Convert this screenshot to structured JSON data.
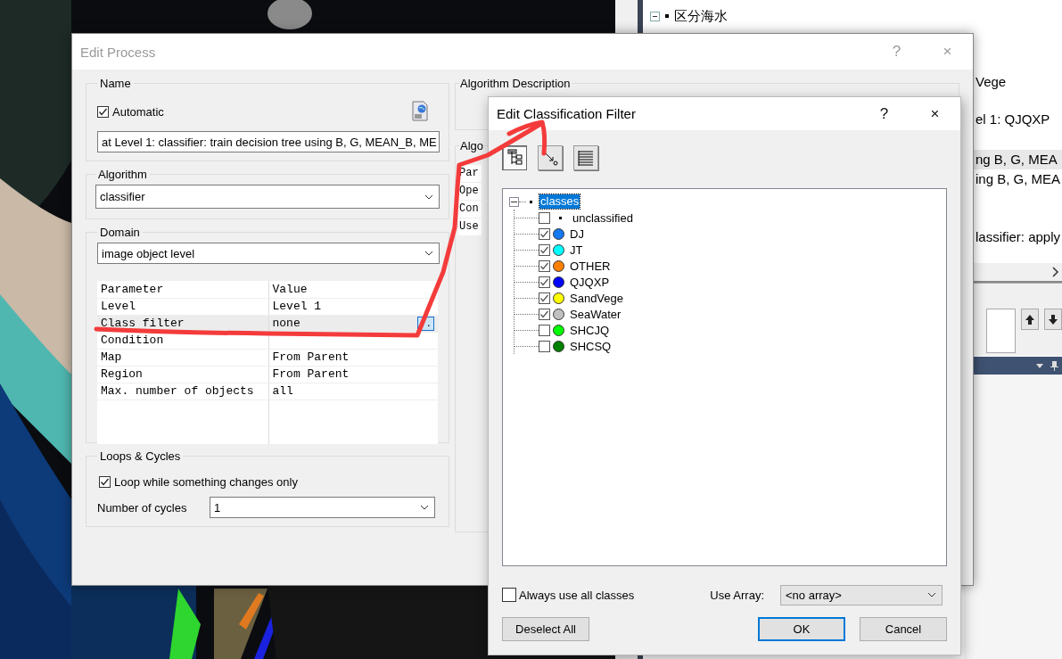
{
  "background_window": {
    "tree_item": {
      "label": "区分海水",
      "expanded": true
    },
    "lines": [
      {
        "text": "Vege",
        "selected": false
      },
      {
        "text": "el 1: QJQXP",
        "selected": false
      },
      {
        "text": "ng B, G, MEA",
        "selected": true
      },
      {
        "text": "ing B, G, MEA",
        "selected": false
      },
      {
        "text": "lassifier: apply",
        "selected": false
      }
    ]
  },
  "edit_process": {
    "title": "Edit Process",
    "controls": [
      "?",
      "×"
    ],
    "name": {
      "label": "Name",
      "automatic": {
        "label": "Automatic",
        "checked": true
      },
      "value": "at  Level 1: classifier: train decision tree using B, G, MEAN_B, ME"
    },
    "algorithm": {
      "label": "Algorithm",
      "value": "classifier"
    },
    "domain": {
      "label": "Domain",
      "value": "image object level",
      "columns": [
        "Parameter",
        "Value"
      ],
      "rows": [
        {
          "parameter": "Level",
          "value": "Level 1",
          "selected": false
        },
        {
          "parameter": "Class filter",
          "value": "none",
          "button": "..",
          "selected": true
        },
        {
          "parameter": "Condition",
          "selected": false
        },
        {
          "parameter": "Map",
          "value": "From Parent",
          "selected": false
        },
        {
          "parameter": "Region",
          "value": "From Parent",
          "selected": false
        },
        {
          "parameter": "Max. number of objects",
          "value": "all",
          "selected": false
        }
      ]
    },
    "loops": {
      "label": "Loops & Cycles",
      "loop": {
        "label": "Loop while something changes only",
        "checked": true
      },
      "cycles_label": "Number of cycles",
      "cycles_value": "1"
    },
    "description": {
      "label": "Algorithm Description"
    },
    "parameters": {
      "label": "Algo",
      "rows": [
        "Par",
        "Ope",
        "Con",
        "Use"
      ]
    }
  },
  "filter_dialog": {
    "title": "Edit Classification Filter",
    "controls": [
      "?",
      "×"
    ],
    "toolbar": [
      {
        "kind": "tree",
        "pressed": true
      },
      {
        "kind": "arrow",
        "pressed": false
      },
      {
        "kind": "list",
        "pressed": false
      }
    ],
    "tree": {
      "label": "classes",
      "expanded": true,
      "selected": true,
      "children": [
        {
          "label": "unclassified",
          "checked": false,
          "kind": "plain"
        },
        {
          "label": "DJ",
          "checked": true,
          "kind": "class",
          "color": "#1478f0"
        },
        {
          "label": "JT",
          "checked": true,
          "kind": "class",
          "color": "#00ffff"
        },
        {
          "label": "OTHER",
          "checked": true,
          "kind": "class",
          "color": "#ff8000"
        },
        {
          "label": "QJQXP",
          "checked": true,
          "kind": "class",
          "color": "#0000ff"
        },
        {
          "label": "SandVege",
          "checked": true,
          "kind": "class",
          "color": "#ffff00"
        },
        {
          "label": "SeaWater",
          "checked": true,
          "kind": "class",
          "color": "#c0c0c0"
        },
        {
          "label": "SHCJQ",
          "checked": false,
          "kind": "class",
          "color": "#00ff00"
        },
        {
          "label": "SHCSQ",
          "checked": false,
          "kind": "class",
          "color": "#008000"
        }
      ]
    },
    "always_use": {
      "label": "Always use all classes",
      "checked": false
    },
    "use_array": {
      "label": "Use Array:",
      "value": "<no array>"
    },
    "buttons": [
      {
        "label": "Deselect All",
        "default": false
      },
      {
        "label": "OK",
        "default": true
      },
      {
        "label": "Cancel",
        "default": false
      }
    ]
  }
}
